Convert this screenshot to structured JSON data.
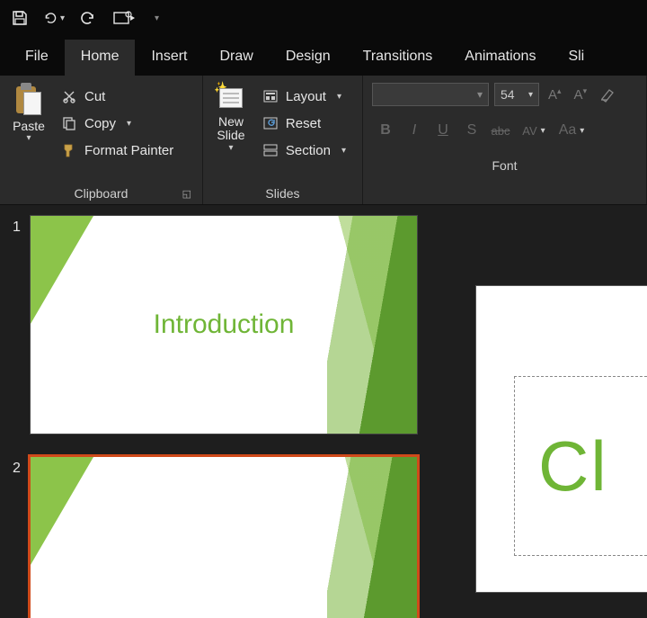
{
  "qat": {
    "save": "save",
    "undo": "undo",
    "redo": "redo",
    "start_from_beginning": "start-from-beginning"
  },
  "tabs": {
    "file": "File",
    "home": "Home",
    "insert": "Insert",
    "draw": "Draw",
    "design": "Design",
    "transitions": "Transitions",
    "animations": "Animations",
    "slideshow": "Sli"
  },
  "ribbon": {
    "clipboard": {
      "paste": "Paste",
      "cut": "Cut",
      "copy": "Copy",
      "format_painter": "Format Painter",
      "group_label": "Clipboard"
    },
    "slides": {
      "new_slide": "New\nSlide",
      "new_slide_l1": "New",
      "new_slide_l2": "Slide",
      "layout": "Layout",
      "reset": "Reset",
      "section": "Section",
      "group_label": "Slides"
    },
    "font": {
      "size_value": "54",
      "group_label": "Font",
      "bold": "B",
      "italic": "I",
      "underline": "U",
      "shadow": "S",
      "strike": "abc",
      "spacing": "AV",
      "case": "Aa"
    }
  },
  "thumbnails": [
    {
      "num": "1",
      "title": "Introduction",
      "selected": false
    },
    {
      "num": "2",
      "title": "",
      "selected": true
    }
  ],
  "editor": {
    "placeholder_text": "Cl"
  },
  "colors": {
    "accent_green": "#6fb536",
    "selection_orange": "#d04a1a",
    "ribbon_bg": "#2b2b2b",
    "app_bg": "#0a0a0a"
  }
}
